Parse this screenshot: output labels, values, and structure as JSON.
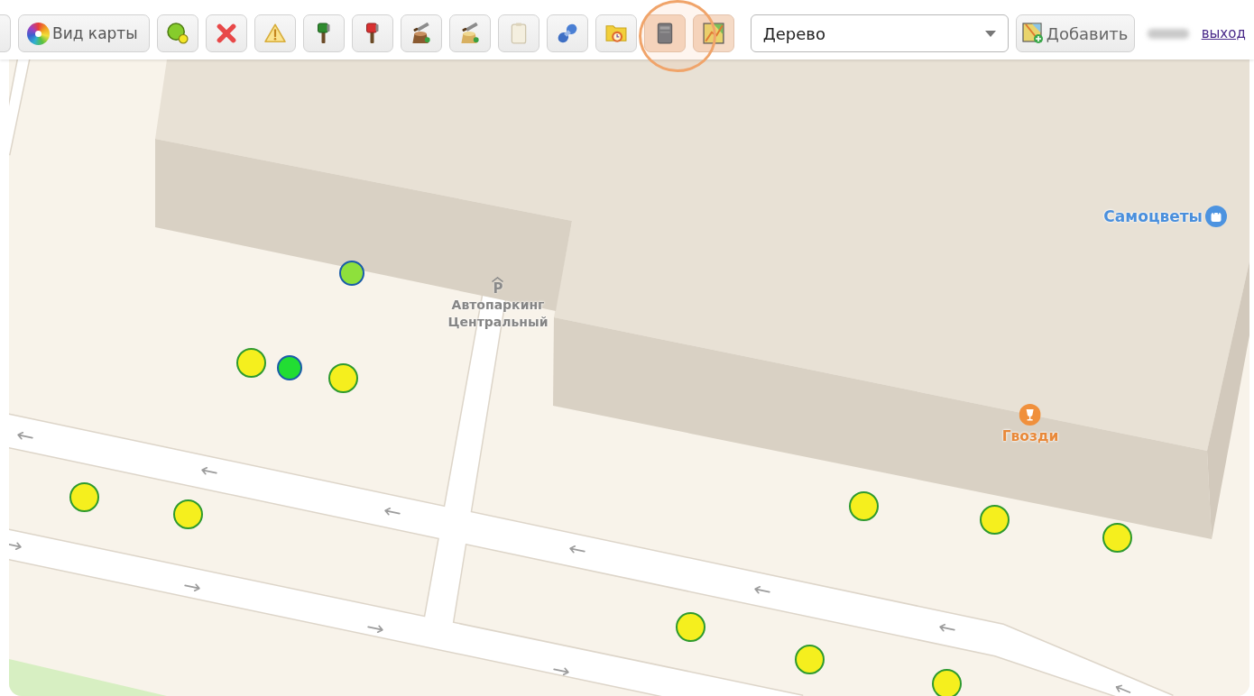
{
  "toolbar": {
    "map_view_button": {
      "label": "Вид карты"
    },
    "tool_buttons": [
      {
        "highlighted": false
      },
      {
        "highlighted": false
      },
      {
        "highlighted": false
      },
      {
        "highlighted": false
      },
      {
        "highlighted": false
      },
      {
        "highlighted": false
      },
      {
        "highlighted": false
      },
      {
        "highlighted": false
      },
      {
        "highlighted": false
      },
      {
        "highlighted": false
      },
      {
        "highlighted": true
      },
      {
        "highlighted": true
      }
    ],
    "object_type_select": {
      "value": "Дерево"
    },
    "add_button": {
      "label": "Добавить"
    },
    "logout_link": {
      "label": "выход"
    }
  },
  "map": {
    "places": [
      {
        "kind": "shop",
        "name": "Самоцветы"
      },
      {
        "kind": "parking",
        "symbol": "P",
        "name": "Автопаркинг Центральный"
      },
      {
        "kind": "store",
        "name": "Гвозди"
      }
    ],
    "markers": [
      {
        "kind": "alternate",
        "color": "#8ee03c"
      },
      {
        "kind": "standard",
        "color": "#f5ef1e"
      },
      {
        "kind": "alternate",
        "color": "#22dd33"
      },
      {
        "kind": "standard",
        "color": "#f5ef1e"
      },
      {
        "kind": "standard",
        "color": "#f5ef1e"
      },
      {
        "kind": "standard",
        "color": "#f5ef1e"
      },
      {
        "kind": "standard",
        "color": "#f5ef1e"
      },
      {
        "kind": "standard",
        "color": "#f5ef1e"
      },
      {
        "kind": "standard",
        "color": "#f5ef1e"
      },
      {
        "kind": "standard",
        "color": "#f5ef1e"
      },
      {
        "kind": "standard",
        "color": "#f5ef1e"
      },
      {
        "kind": "standard",
        "color": "#f5ef1e"
      }
    ]
  }
}
